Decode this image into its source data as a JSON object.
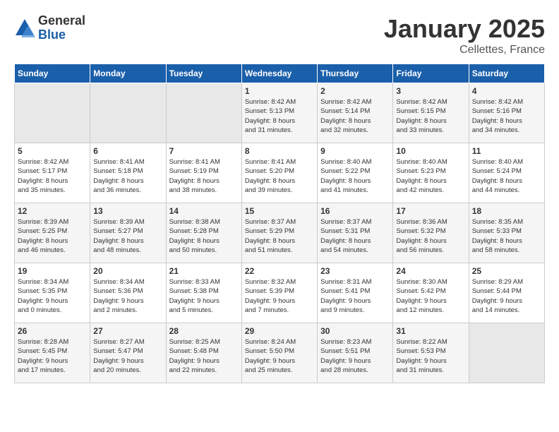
{
  "header": {
    "logo_general": "General",
    "logo_blue": "Blue",
    "month": "January 2025",
    "location": "Cellettes, France"
  },
  "days_of_week": [
    "Sunday",
    "Monday",
    "Tuesday",
    "Wednesday",
    "Thursday",
    "Friday",
    "Saturday"
  ],
  "weeks": [
    [
      {
        "day": "",
        "info": ""
      },
      {
        "day": "",
        "info": ""
      },
      {
        "day": "",
        "info": ""
      },
      {
        "day": "1",
        "info": "Sunrise: 8:42 AM\nSunset: 5:13 PM\nDaylight: 8 hours\nand 31 minutes."
      },
      {
        "day": "2",
        "info": "Sunrise: 8:42 AM\nSunset: 5:14 PM\nDaylight: 8 hours\nand 32 minutes."
      },
      {
        "day": "3",
        "info": "Sunrise: 8:42 AM\nSunset: 5:15 PM\nDaylight: 8 hours\nand 33 minutes."
      },
      {
        "day": "4",
        "info": "Sunrise: 8:42 AM\nSunset: 5:16 PM\nDaylight: 8 hours\nand 34 minutes."
      }
    ],
    [
      {
        "day": "5",
        "info": "Sunrise: 8:42 AM\nSunset: 5:17 PM\nDaylight: 8 hours\nand 35 minutes."
      },
      {
        "day": "6",
        "info": "Sunrise: 8:41 AM\nSunset: 5:18 PM\nDaylight: 8 hours\nand 36 minutes."
      },
      {
        "day": "7",
        "info": "Sunrise: 8:41 AM\nSunset: 5:19 PM\nDaylight: 8 hours\nand 38 minutes."
      },
      {
        "day": "8",
        "info": "Sunrise: 8:41 AM\nSunset: 5:20 PM\nDaylight: 8 hours\nand 39 minutes."
      },
      {
        "day": "9",
        "info": "Sunrise: 8:40 AM\nSunset: 5:22 PM\nDaylight: 8 hours\nand 41 minutes."
      },
      {
        "day": "10",
        "info": "Sunrise: 8:40 AM\nSunset: 5:23 PM\nDaylight: 8 hours\nand 42 minutes."
      },
      {
        "day": "11",
        "info": "Sunrise: 8:40 AM\nSunset: 5:24 PM\nDaylight: 8 hours\nand 44 minutes."
      }
    ],
    [
      {
        "day": "12",
        "info": "Sunrise: 8:39 AM\nSunset: 5:25 PM\nDaylight: 8 hours\nand 46 minutes."
      },
      {
        "day": "13",
        "info": "Sunrise: 8:39 AM\nSunset: 5:27 PM\nDaylight: 8 hours\nand 48 minutes."
      },
      {
        "day": "14",
        "info": "Sunrise: 8:38 AM\nSunset: 5:28 PM\nDaylight: 8 hours\nand 50 minutes."
      },
      {
        "day": "15",
        "info": "Sunrise: 8:37 AM\nSunset: 5:29 PM\nDaylight: 8 hours\nand 51 minutes."
      },
      {
        "day": "16",
        "info": "Sunrise: 8:37 AM\nSunset: 5:31 PM\nDaylight: 8 hours\nand 54 minutes."
      },
      {
        "day": "17",
        "info": "Sunrise: 8:36 AM\nSunset: 5:32 PM\nDaylight: 8 hours\nand 56 minutes."
      },
      {
        "day": "18",
        "info": "Sunrise: 8:35 AM\nSunset: 5:33 PM\nDaylight: 8 hours\nand 58 minutes."
      }
    ],
    [
      {
        "day": "19",
        "info": "Sunrise: 8:34 AM\nSunset: 5:35 PM\nDaylight: 9 hours\nand 0 minutes."
      },
      {
        "day": "20",
        "info": "Sunrise: 8:34 AM\nSunset: 5:36 PM\nDaylight: 9 hours\nand 2 minutes."
      },
      {
        "day": "21",
        "info": "Sunrise: 8:33 AM\nSunset: 5:38 PM\nDaylight: 9 hours\nand 5 minutes."
      },
      {
        "day": "22",
        "info": "Sunrise: 8:32 AM\nSunset: 5:39 PM\nDaylight: 9 hours\nand 7 minutes."
      },
      {
        "day": "23",
        "info": "Sunrise: 8:31 AM\nSunset: 5:41 PM\nDaylight: 9 hours\nand 9 minutes."
      },
      {
        "day": "24",
        "info": "Sunrise: 8:30 AM\nSunset: 5:42 PM\nDaylight: 9 hours\nand 12 minutes."
      },
      {
        "day": "25",
        "info": "Sunrise: 8:29 AM\nSunset: 5:44 PM\nDaylight: 9 hours\nand 14 minutes."
      }
    ],
    [
      {
        "day": "26",
        "info": "Sunrise: 8:28 AM\nSunset: 5:45 PM\nDaylight: 9 hours\nand 17 minutes."
      },
      {
        "day": "27",
        "info": "Sunrise: 8:27 AM\nSunset: 5:47 PM\nDaylight: 9 hours\nand 20 minutes."
      },
      {
        "day": "28",
        "info": "Sunrise: 8:25 AM\nSunset: 5:48 PM\nDaylight: 9 hours\nand 22 minutes."
      },
      {
        "day": "29",
        "info": "Sunrise: 8:24 AM\nSunset: 5:50 PM\nDaylight: 9 hours\nand 25 minutes."
      },
      {
        "day": "30",
        "info": "Sunrise: 8:23 AM\nSunset: 5:51 PM\nDaylight: 9 hours\nand 28 minutes."
      },
      {
        "day": "31",
        "info": "Sunrise: 8:22 AM\nSunset: 5:53 PM\nDaylight: 9 hours\nand 31 minutes."
      },
      {
        "day": "",
        "info": ""
      }
    ]
  ],
  "empty_weeks": [
    0,
    1,
    2,
    3,
    4
  ],
  "first_week_empties": [
    0,
    1,
    2
  ]
}
